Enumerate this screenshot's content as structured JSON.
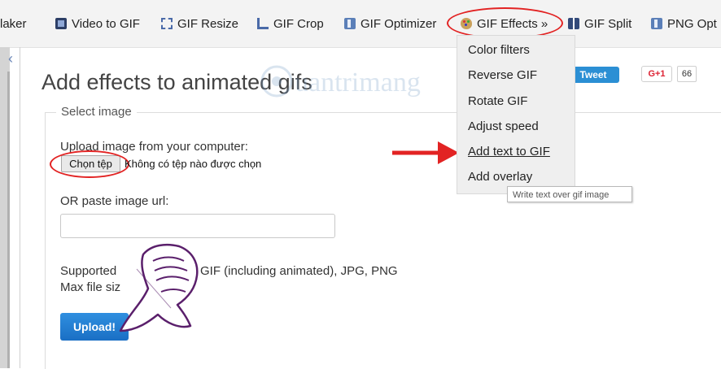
{
  "nav": {
    "items": [
      {
        "label": "laker",
        "icon": ""
      },
      {
        "label": "Video to GIF",
        "icon": "film-icon"
      },
      {
        "label": "GIF Resize",
        "icon": "resize-icon"
      },
      {
        "label": "GIF Crop",
        "icon": "crop-icon"
      },
      {
        "label": "GIF Optimizer",
        "icon": "optimizer-icon"
      },
      {
        "label": "GIF Effects »",
        "icon": "palette-icon"
      },
      {
        "label": "GIF Split",
        "icon": "split-icon"
      },
      {
        "label": "PNG Opt",
        "icon": "optimizer-icon"
      }
    ]
  },
  "effects_menu": {
    "items": [
      "Color filters",
      "Reverse GIF",
      "Rotate GIF",
      "Adjust speed",
      "Add text to GIF",
      "Add overlay"
    ],
    "highlighted": "Add text to GIF",
    "tooltip": "Write text over gif image"
  },
  "page": {
    "title": "Add effects to animated gifs",
    "tweet": "Tweet",
    "gplus": "G+1",
    "gplus_count": "66",
    "watermark": "Quantrimang"
  },
  "form": {
    "legend": "Select image",
    "upload_label": "Upload image from your computer:",
    "choose_button": "Chọn tệp",
    "no_file": "Không có tệp nào được chọn",
    "url_label": "OR paste image url:",
    "url_value": "",
    "supported_prefix": "Supported",
    "supported_formats": "GIF (including animated), JPG, PNG",
    "max_size": "Max file siz",
    "upload_button": "Upload!"
  },
  "colors": {
    "annotation_red": "#e22323",
    "upload_blue": "#1a6fc4",
    "tweet_blue": "#2b8fd4",
    "hand_purple": "#5a1f6b"
  }
}
